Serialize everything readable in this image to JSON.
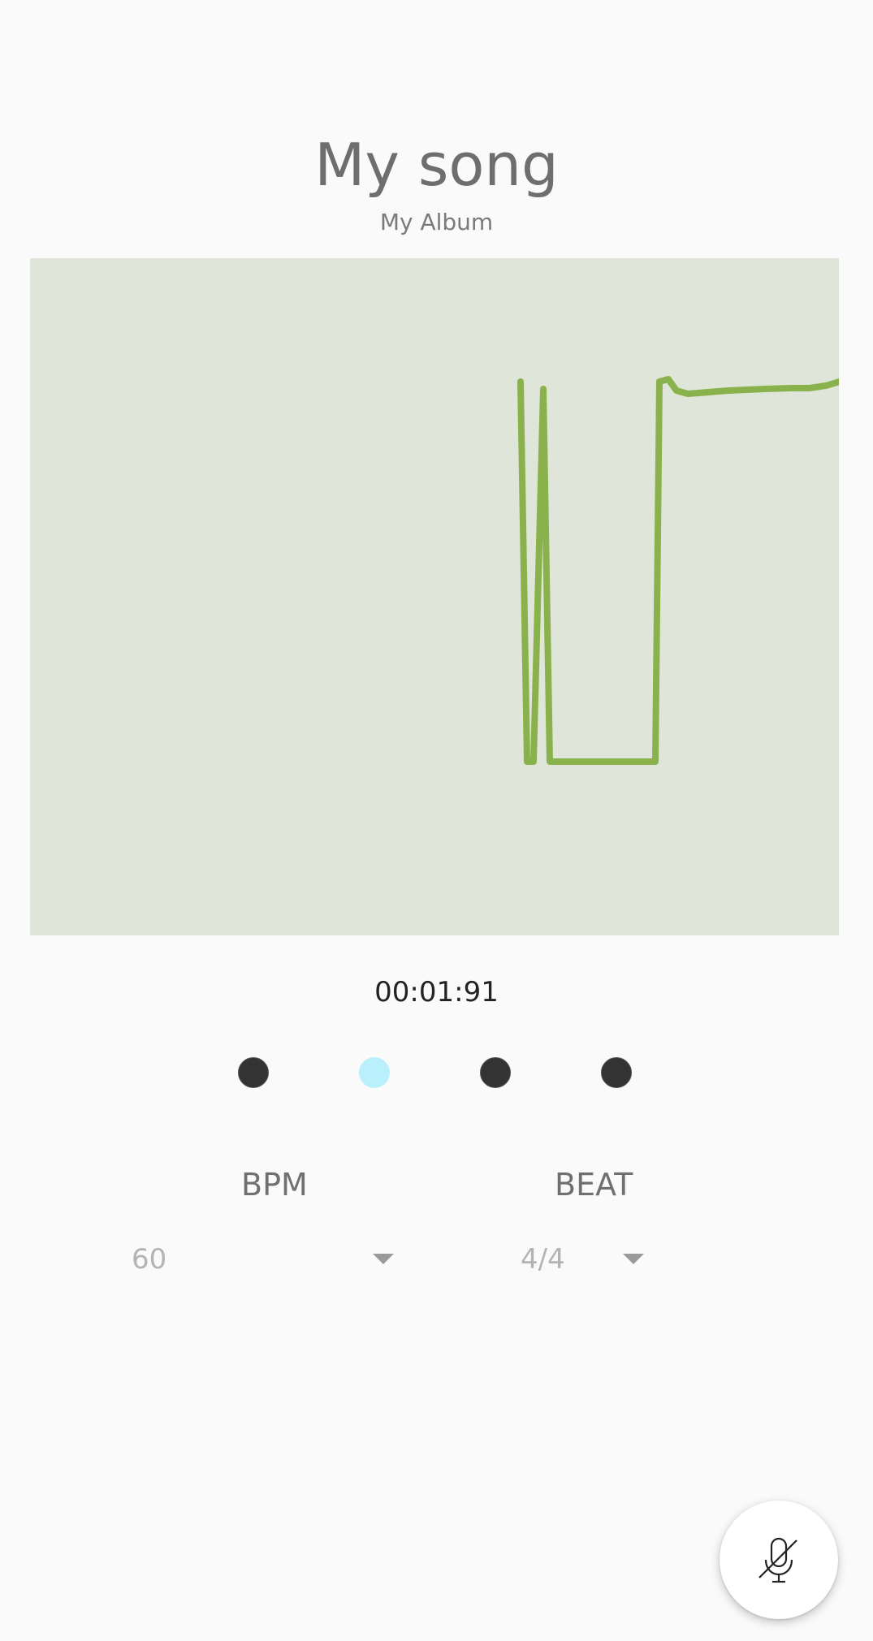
{
  "song": {
    "title": "My song",
    "album": "My Album"
  },
  "waveform": {
    "color": "#8ab24c",
    "background": "#dfe5d9"
  },
  "playback": {
    "time": "00:01:91"
  },
  "beat_indicators": [
    {
      "state": "inactive",
      "color": "#333333"
    },
    {
      "state": "active",
      "color": "#b9f0fb"
    },
    {
      "state": "inactive",
      "color": "#333333"
    },
    {
      "state": "inactive",
      "color": "#333333"
    }
  ],
  "bpm": {
    "label": "BPM",
    "value": "60"
  },
  "beat": {
    "label": "BEAT",
    "value": "4/4"
  },
  "fab": {
    "icon": "mic-off-icon"
  }
}
